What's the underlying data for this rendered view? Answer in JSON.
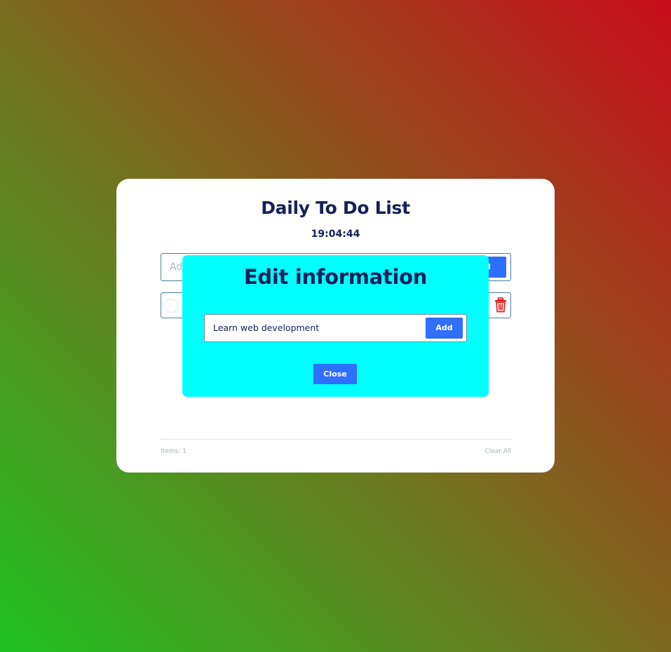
{
  "app": {
    "title": "Daily To Do List",
    "clock": "19:04:44"
  },
  "add_form": {
    "placeholder": "Add",
    "button_label": "dd"
  },
  "todos": [
    {
      "text": "",
      "icons": [
        "checkbox-circle",
        "trash-icon"
      ]
    }
  ],
  "footer": {
    "items_label": "Items: 1",
    "clear_all": "Clear All"
  },
  "modal": {
    "title": "Edit information",
    "input_value": "Learn web development",
    "add_label": "Add",
    "close_label": "Close"
  },
  "colors": {
    "accent": "#2f6ffe",
    "modal_bg": "#00ffff",
    "title": "#13215a",
    "delete": "#e0201b"
  }
}
